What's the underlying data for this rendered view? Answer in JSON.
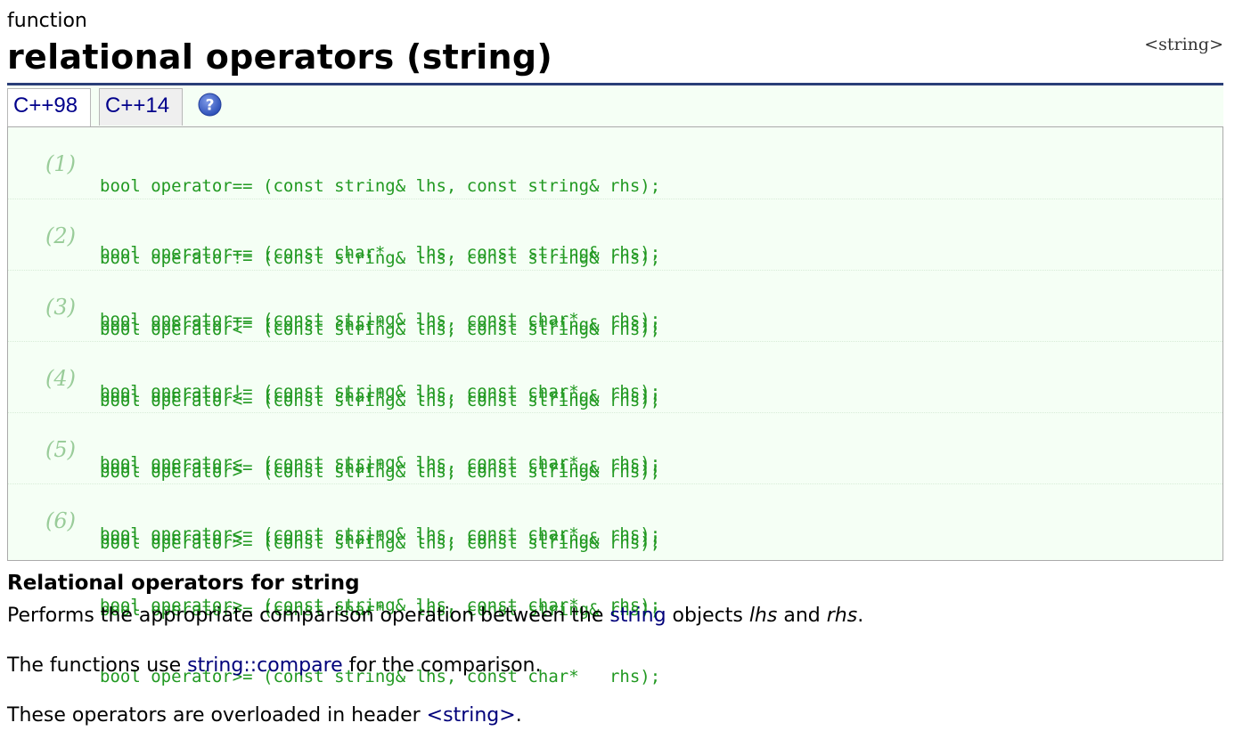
{
  "page": {
    "kind": "function",
    "title": "relational operators (string)",
    "header_link": "<string>"
  },
  "tabs": [
    {
      "label": "C++98",
      "active": true
    },
    {
      "label": "C++14",
      "active": false
    }
  ],
  "help_icon": "question-circle-icon",
  "colors": {
    "rule": "#2a3e78",
    "code_text": "#229922",
    "overload_number": "#99cc99",
    "link": "#00007a",
    "code_bg": "#f5fff5"
  },
  "overloads": [
    {
      "number": "(1)",
      "lines": [
        "bool operator== (const string& lhs, const string& rhs);",
        "bool operator== (const char*   lhs, const string& rhs);",
        "bool operator== (const string& lhs, const char*   rhs);"
      ]
    },
    {
      "number": "(2)",
      "lines": [
        "bool operator!= (const string& lhs, const string& rhs);",
        "bool operator!= (const char*   lhs, const string& rhs);",
        "bool operator!= (const string& lhs, const char*   rhs);"
      ]
    },
    {
      "number": "(3)",
      "lines": [
        "bool operator<  (const string& lhs, const string& rhs);",
        "bool operator<  (const char*   lhs, const string& rhs);",
        "bool operator<  (const string& lhs, const char*   rhs);"
      ]
    },
    {
      "number": "(4)",
      "lines": [
        "bool operator<= (const string& lhs, const string& rhs);",
        "bool operator<= (const char*   lhs, const string& rhs);",
        "bool operator<= (const string& lhs, const char*   rhs);"
      ]
    },
    {
      "number": "(5)",
      "lines": [
        "bool operator>  (const string& lhs, const string& rhs);",
        "bool operator>  (const char*   lhs, const string& rhs);",
        "bool operator>  (const string& lhs, const char*   rhs);"
      ]
    },
    {
      "number": "(6)",
      "lines": [
        "bool operator>= (const string& lhs, const string& rhs);",
        "bool operator>= (const char*   lhs, const string& rhs);",
        "bool operator>= (const string& lhs, const char*   rhs);"
      ]
    }
  ],
  "description": {
    "heading": "Relational operators for string",
    "p1": {
      "before": "Performs the appropriate comparison operation between the ",
      "link": "string",
      "middle": " objects ",
      "lhs": "lhs",
      "and": " and ",
      "rhs": "rhs",
      "end": "."
    },
    "p2": {
      "before": "The functions use ",
      "link": "string::compare",
      "after": " for the comparison."
    },
    "p3": {
      "before": "These operators are overloaded in header ",
      "link": "<string>",
      "after": "."
    }
  }
}
